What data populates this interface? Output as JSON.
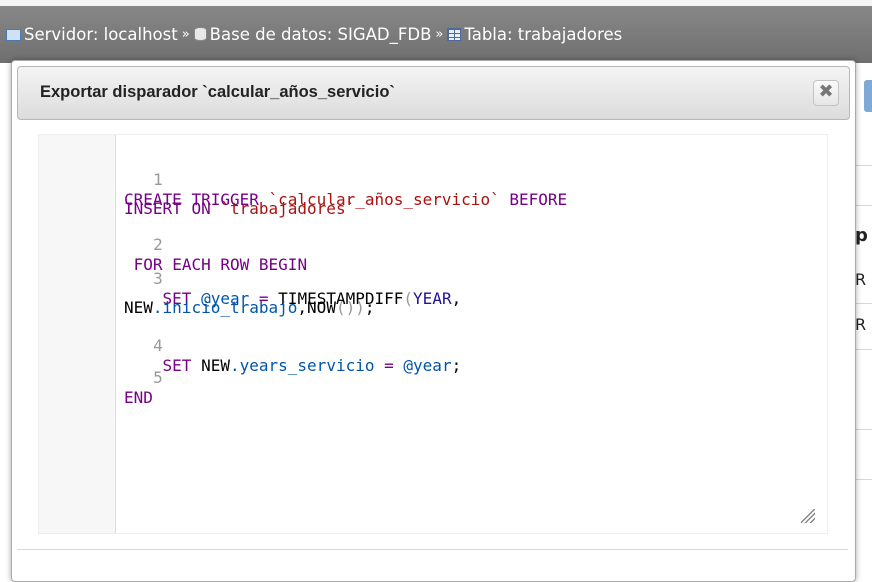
{
  "breadcrumb": {
    "server": "Servidor: localhost",
    "database": "Base de datos: SIGAD_FDB",
    "table": "Tabla: trabajadores",
    "separator": "»"
  },
  "background_page": {
    "fragments": [
      "p",
      "R",
      "R"
    ]
  },
  "dialog": {
    "title": "Exportar disparador `calcular_años_servicio`",
    "close_symbol": "✖"
  },
  "editor": {
    "lines": [
      {
        "num": "1",
        "wrap1": "CREATE TRIGGER `calcular_años_servicio` BEFORE",
        "wrap2": "INSERT ON `trabajadores`"
      },
      {
        "num": "2",
        "text": " FOR EACH ROW BEGIN"
      },
      {
        "num": "3",
        "wrap1": "    SET @year = TIMESTAMPDIFF(YEAR,",
        "wrap2": "NEW.inicio_trabajo,NOW());"
      },
      {
        "num": "4",
        "text": "    SET NEW.years_servicio = @year;"
      },
      {
        "num": "5",
        "text": "END"
      }
    ]
  },
  "colors": {
    "keyword": "#770088",
    "string": "#aa1111",
    "variable": "#0055aa",
    "operator": "#981a1a",
    "line_number": "#999999"
  }
}
